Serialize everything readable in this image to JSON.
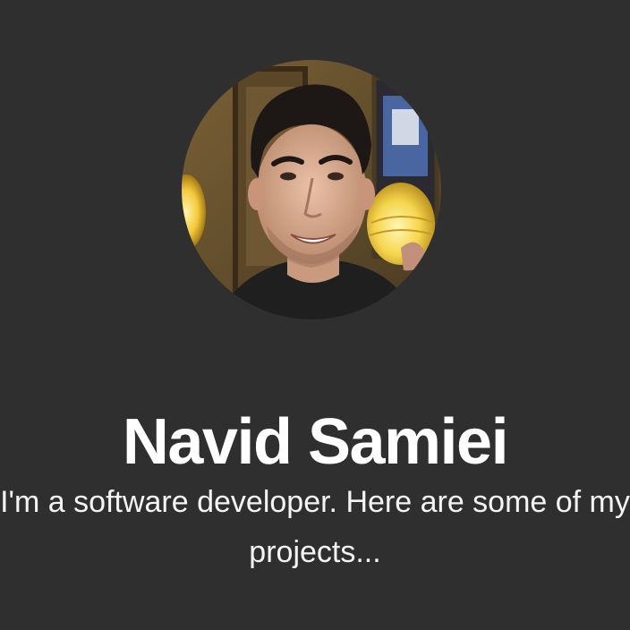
{
  "profile": {
    "name": "Navid Samiei",
    "bio_line_1": "I'm a software developer. Here are some of my",
    "bio_line_2": "projects...",
    "avatar_alt": "Navid Samiei"
  },
  "colors": {
    "background": "#2f2f2f",
    "text": "#ffffff"
  }
}
